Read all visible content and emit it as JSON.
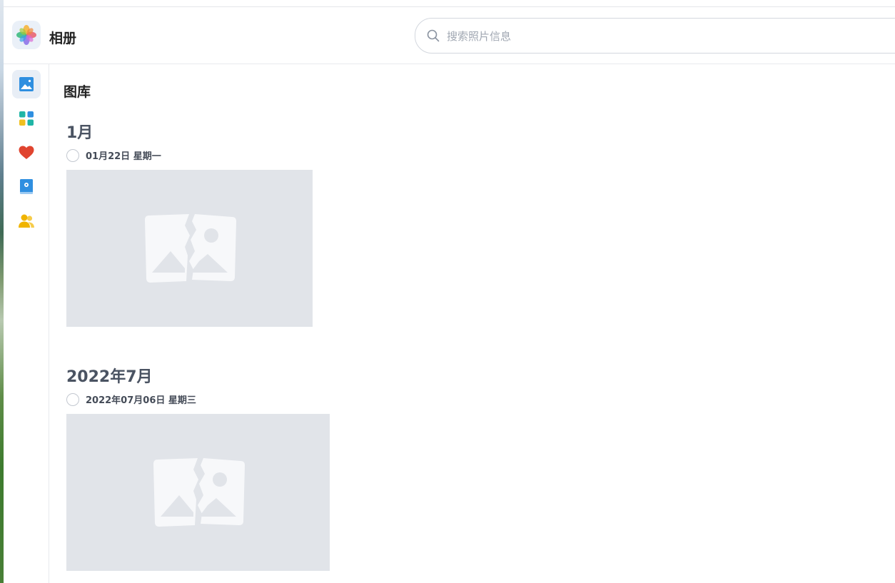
{
  "app": {
    "title": "相册",
    "logo_icon": "album-flower-icon"
  },
  "search": {
    "placeholder": "搜索照片信息",
    "value": "",
    "icon": "search-icon"
  },
  "sidebar": {
    "items": [
      {
        "key": "gallery",
        "icon": "gallery-image-icon",
        "active": true,
        "color": "#2f8fe0"
      },
      {
        "key": "albums",
        "icon": "albums-grid-icon",
        "active": false,
        "color": "#1fb5a6"
      },
      {
        "key": "favorites",
        "icon": "heart-icon",
        "active": false,
        "color": "#e0442f"
      },
      {
        "key": "memories",
        "icon": "book-icon",
        "active": false,
        "color": "#2f8fe0"
      },
      {
        "key": "people",
        "icon": "people-icon",
        "active": false,
        "color": "#f0b400"
      }
    ]
  },
  "main": {
    "title": "图库",
    "groups": [
      {
        "month": "1月",
        "date": "01月22日 星期一",
        "photo_state": "broken-image"
      },
      {
        "month": "2022年7月",
        "date": "2022年07月06日 星期三",
        "photo_state": "broken-image"
      }
    ]
  },
  "colors": {
    "accent": "#2f8fe0",
    "placeholder_bg": "#e1e4e9"
  }
}
